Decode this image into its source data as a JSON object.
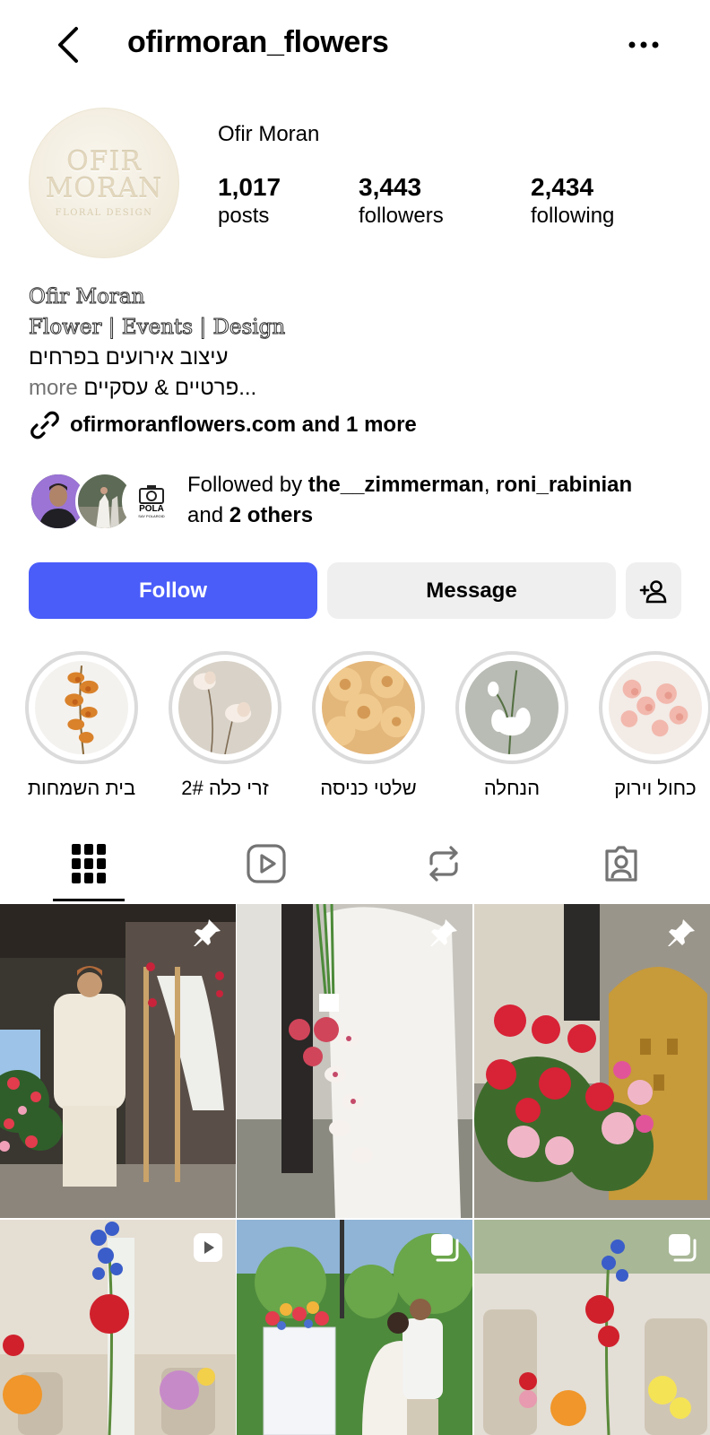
{
  "header": {
    "back_icon": "chevron-left-icon",
    "username": "ofirmoran_flowers",
    "more_icon": "more-horizontal-icon"
  },
  "profile": {
    "avatar_text": {
      "line1": "OFIR",
      "line2": "MORAN",
      "line3": "FLORAL DESIGN"
    },
    "display_name": "Ofir Moran",
    "stats": [
      {
        "value": "1,017",
        "label": "posts"
      },
      {
        "value": "3,443",
        "label": "followers"
      },
      {
        "value": "2,434",
        "label": "following"
      }
    ]
  },
  "bio": {
    "line1": "Ofir Moran",
    "line2": "Flower | Events | Design",
    "line3": "עיצוב אירועים בפרחים",
    "line4_more": "more",
    "line4_text": "...פרטיים & עסקיים",
    "link_icon": "link-icon",
    "link_text": "ofirmoranflowers.com and 1 more"
  },
  "followed_by": {
    "prefix": "Followed by ",
    "user1": "the__zimmerman",
    "sep": ", ",
    "user2": "roni_rabinian",
    "and": "and ",
    "others": "2 others",
    "badge_text_1": "POLA",
    "badge_text_2": "SAY POLAROID"
  },
  "actions": {
    "follow_label": "Follow",
    "message_label": "Message",
    "add_user_icon": "person-add-icon"
  },
  "highlights": [
    {
      "label": "בית השמחות"
    },
    {
      "label": "זרי כלה 2#"
    },
    {
      "label": "שלטי כניסה"
    },
    {
      "label": "הנחלה"
    },
    {
      "label": "כחול וירוק"
    }
  ],
  "tabs": [
    {
      "name": "posts",
      "icon": "grid-icon"
    },
    {
      "name": "reels",
      "icon": "reels-play-icon"
    },
    {
      "name": "reposts",
      "icon": "repost-icon"
    },
    {
      "name": "tagged",
      "icon": "tagged-person-icon"
    }
  ],
  "grid": [
    {
      "badge": "pin-icon"
    },
    {
      "badge": "pin-icon"
    },
    {
      "badge": "pin-icon"
    },
    {
      "badge": "reel-icon"
    },
    {
      "badge": "carousel-icon"
    },
    {
      "badge": "carousel-icon"
    }
  ],
  "colors": {
    "follow_button": "#4a5df9",
    "secondary_button": "#efefef",
    "muted_text": "#737373"
  }
}
